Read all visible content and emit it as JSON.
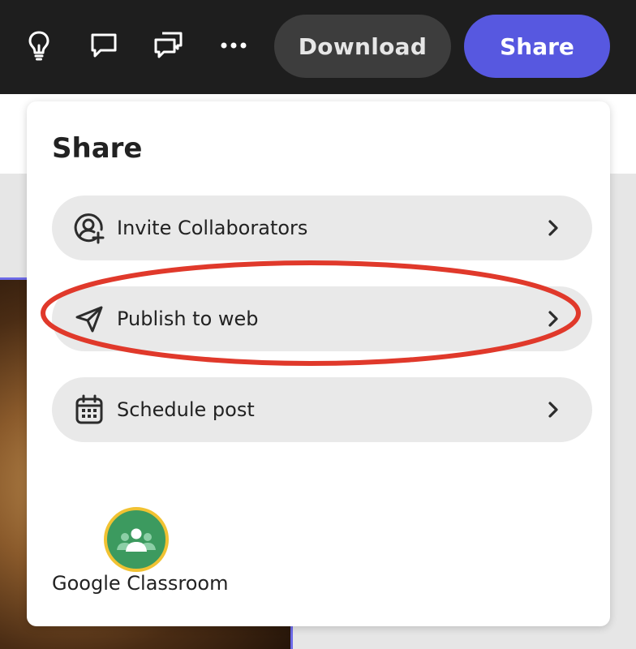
{
  "toolbar": {
    "icons": [
      "lightbulb-icon",
      "comment-icon",
      "comments-icon",
      "more-icon"
    ],
    "download_label": "Download",
    "share_label": "Share",
    "colors": {
      "background": "#1e1e1e",
      "download_bg": "#3d3d3d",
      "share_bg": "#5758e0"
    }
  },
  "share_panel": {
    "title": "Share",
    "items": [
      {
        "label": "Invite Collaborators",
        "icon": "add-user-icon"
      },
      {
        "label": "Publish to web",
        "icon": "send-icon",
        "highlighted": true
      },
      {
        "label": "Schedule post",
        "icon": "calendar-icon"
      }
    ],
    "integrations": [
      {
        "label": "Google Classroom",
        "icon": "google-classroom-icon"
      }
    ],
    "highlight_color": "#e0392b"
  }
}
